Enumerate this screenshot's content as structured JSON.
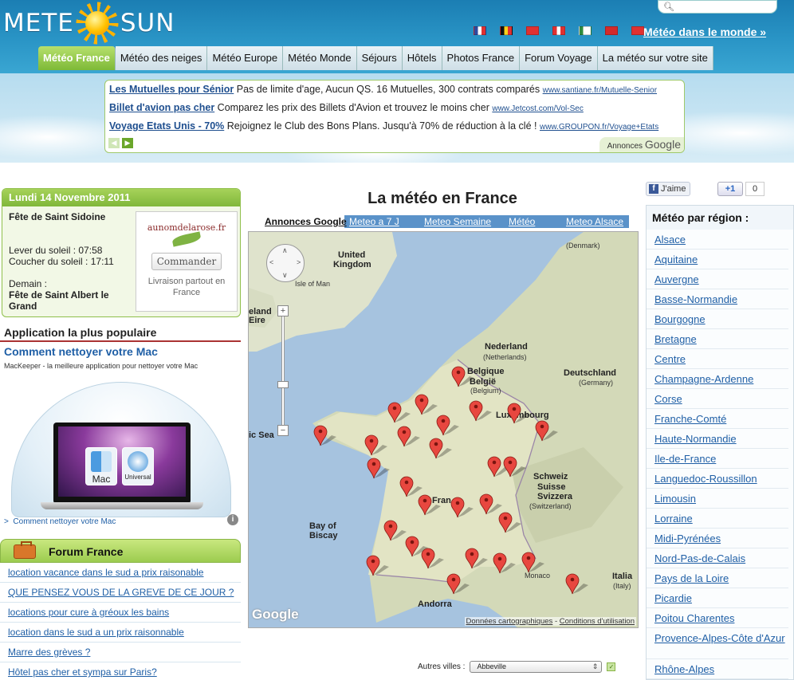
{
  "header": {
    "logo_left": "METE",
    "logo_right": "SUN",
    "world_link": "Météo dans le monde »",
    "flags": [
      {
        "name": "france-flag-icon",
        "colors": [
          "#2d4aa0",
          "#ffffff",
          "#e03131"
        ]
      },
      {
        "name": "belgium-flag-icon",
        "colors": [
          "#111111",
          "#f7d21a",
          "#e03131"
        ]
      },
      {
        "name": "switzerland-flag-icon",
        "colors": [
          "#e03131",
          "#e03131",
          "#e03131"
        ]
      },
      {
        "name": "canada-flag-icon",
        "colors": [
          "#e03131",
          "#ffffff",
          "#e03131"
        ]
      },
      {
        "name": "algeria-flag-icon",
        "colors": [
          "#2e8b3e",
          "#ffffff",
          "#ffffff"
        ]
      },
      {
        "name": "morocco-flag-icon",
        "colors": [
          "#d42a2a",
          "#d42a2a",
          "#d42a2a"
        ]
      },
      {
        "name": "tunisia-flag-icon",
        "colors": [
          "#e03131",
          "#e03131",
          "#e03131"
        ]
      }
    ]
  },
  "nav": {
    "tabs": [
      {
        "label": "Météo France",
        "active": true
      },
      {
        "label": "Météo des neiges",
        "active": false
      },
      {
        "label": "Météo Europe",
        "active": false
      },
      {
        "label": "Météo Monde",
        "active": false
      },
      {
        "label": "Séjours",
        "active": false
      },
      {
        "label": "Hôtels",
        "active": false
      },
      {
        "label": "Photos France",
        "active": false
      },
      {
        "label": "Forum Voyage",
        "active": false
      },
      {
        "label": "La météo sur votre site",
        "active": false
      }
    ]
  },
  "ads": {
    "items": [
      {
        "title": "Les Mutuelles pour Sénior",
        "text": "Pas de limite d'age, Aucun QS. 16 Mutuelles, 300 contrats comparés",
        "url": "www.santiane.fr/Mutuelle-Senior"
      },
      {
        "title": "Billet d'avion pas cher",
        "text": "Comparez les prix des Billets d'Avion et trouvez le moins cher",
        "url": "www.Jetcost.com/Vol-Sec"
      },
      {
        "title": "Voyage Etats Unis - 70%",
        "text": "Rejoignez le Club des Bons Plans. Jusqu'à 70% de réduction à la clé !",
        "url": "www.GROUPON.fr/Voyage+Etats"
      }
    ],
    "annonces_label": "Annonces",
    "google_label": "Google"
  },
  "date_box": {
    "date": "Lundi 14 Novembre 2011",
    "saint": "Fête de Saint Sidoine",
    "sunrise": "Lever du soleil : 07:58",
    "sunset": "Coucher du soleil : 17:11",
    "tomorrow_label": "Demain :",
    "tomorrow_saint": "Fête de Saint Albert le Grand",
    "rose_logo": "aunomdelarose.fr",
    "rose_button": "Commander",
    "rose_sub": "Livraison partout en France"
  },
  "app": {
    "heading": "Application la plus populaire",
    "title": "Comment nettoyer votre Mac",
    "desc": "MacKeeper - la meilleure application pour nettoyer votre Mac",
    "tile_mac": "Mac",
    "tile_universal": "Universal",
    "link_arrow": ">",
    "link": "Comment nettoyer votre Mac",
    "info": "i"
  },
  "forum": {
    "title": "Forum France",
    "links": [
      "location vacance dans le sud a prix raisonable",
      "QUE PENSEZ VOUS DE LA GREVE DE CE JOUR ?",
      "locations pour cure à gréoux les bains",
      "location dans le sud a un prix raisonnable",
      "Marre des grèves ?",
      "Hôtel pas cher et sympa sur Paris?"
    ]
  },
  "main": {
    "title": "La météo en France",
    "map_tabs": [
      "Annonces Google",
      "Meteo a 7 J",
      "Meteo Semaine",
      "Météo",
      "Meteo Alsace"
    ],
    "map_footer_data": "Données cartographiques",
    "map_footer_sep": " - ",
    "map_footer_terms": "Conditions d'utilisation",
    "map_brand": "Google",
    "zoom_in": "+",
    "zoom_out": "−",
    "map_labels": [
      {
        "text": "United",
        "sub": false
      },
      {
        "text": "Kingdom",
        "sub": false
      },
      {
        "text": "(Denmark)",
        "sub": true
      },
      {
        "text": "Isle of Man",
        "sub": true
      },
      {
        "text": "eland",
        "sub": false
      },
      {
        "text": "Eire",
        "sub": false
      },
      {
        "text": "Nederland",
        "sub": false
      },
      {
        "text": "(Netherlands)",
        "sub": true
      },
      {
        "text": "Belgique",
        "sub": false
      },
      {
        "text": "België",
        "sub": false
      },
      {
        "text": "(Belgium)",
        "sub": true
      },
      {
        "text": "Deutschland",
        "sub": false
      },
      {
        "text": "(Germany)",
        "sub": true
      },
      {
        "text": "Luxembourg",
        "sub": false
      },
      {
        "text": "ic Sea",
        "sub": false
      },
      {
        "text": "Fran",
        "sub": false
      },
      {
        "text": "Schweiz",
        "sub": false
      },
      {
        "text": "Suisse",
        "sub": false
      },
      {
        "text": "Svizzera",
        "sub": false
      },
      {
        "text": "(Switzerland)",
        "sub": true
      },
      {
        "text": "Bay of",
        "sub": false
      },
      {
        "text": "Biscay",
        "sub": false
      },
      {
        "text": "Monaco",
        "sub": true
      },
      {
        "text": "Italia",
        "sub": false
      },
      {
        "text": "(Italy)",
        "sub": true
      },
      {
        "text": "Andorra",
        "sub": false
      }
    ],
    "other_cities_label": "Autres villes :",
    "other_cities_value": "Abbeville"
  },
  "social": {
    "like": "J'aime",
    "plus_one": "+1",
    "plus_count": "0"
  },
  "regions": {
    "heading": "Météo par région :",
    "items": [
      "Alsace",
      "Aquitaine",
      "Auvergne",
      "Basse-Normandie",
      "Bourgogne",
      "Bretagne",
      "Centre",
      "Champagne-Ardenne",
      "Corse",
      "Franche-Comté",
      "Haute-Normandie",
      "Ile-de-France",
      "Languedoc-Roussillon",
      "Limousin",
      "Lorraine",
      "Midi-Pyrénées",
      "Nord-Pas-de-Calais",
      "Pays de la Loire",
      "Picardie",
      "Poitou Charentes",
      "Provence-Alpes-Côte d'Azur",
      "Rhône-Alpes"
    ]
  },
  "colors": {
    "header_blue": "#1b7eb3",
    "active_tab_green": "#7db937",
    "link_blue": "#1f5fa6",
    "marker_red": "#e8473f"
  }
}
